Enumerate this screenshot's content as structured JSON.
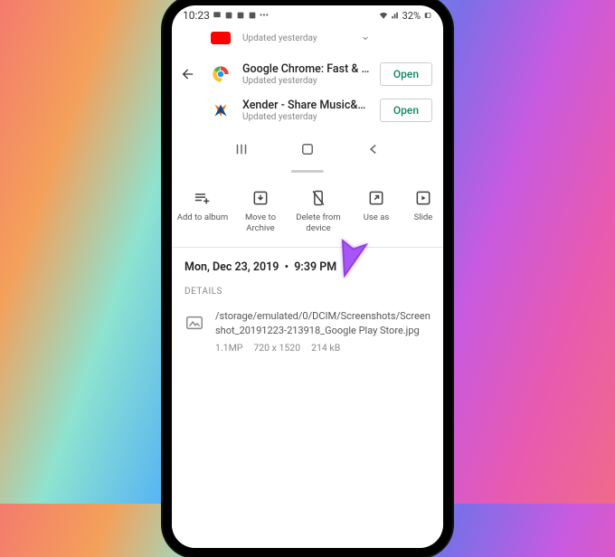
{
  "status": {
    "time": "10:23",
    "battery": "32%"
  },
  "playstore": {
    "apps": [
      {
        "name": "",
        "subtitle": "Updated yesterday",
        "button": ""
      },
      {
        "name": "Google Chrome: Fast & Secure",
        "subtitle": "Updated yesterday",
        "button": "Open"
      },
      {
        "name": "Xender - Share Music&Video, Trans",
        "subtitle": "Updated yesterday",
        "button": "Open"
      }
    ]
  },
  "actions": {
    "add": "Add to album",
    "archive": "Move to Archive",
    "delete": "Delete from device",
    "useas": "Use as",
    "slide": "Slide"
  },
  "details": {
    "date": "Mon, Dec 23, 2019",
    "time": "9:39 PM",
    "heading": "DETAILS",
    "path": "/storage/emulated/0/DCIM/Screenshots/Screenshot_20191223-213918_Google Play Store.jpg",
    "mp": "1.1MP",
    "dim": "720 x 1520",
    "size": "214 kB"
  }
}
